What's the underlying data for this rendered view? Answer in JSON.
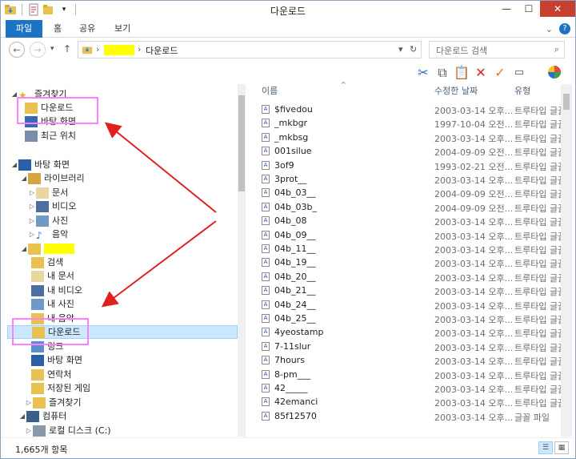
{
  "window": {
    "title": "다운로드",
    "controls": {
      "minimize": "—",
      "maximize": "☐",
      "close": "✕"
    }
  },
  "ribbon": {
    "tabs": [
      "파일",
      "홈",
      "공유",
      "보기"
    ],
    "expand": "⌄",
    "help": "?"
  },
  "address": {
    "crumb_sep": "›",
    "crumbs": [
      "다운로드"
    ],
    "refresh": "↻"
  },
  "search": {
    "placeholder": "다운로드 검색",
    "icon": "search-icon"
  },
  "toolbar": {
    "icons": [
      "scissors-icon",
      "copy-icon",
      "paste-icon",
      "delete-icon",
      "checkmark-icon",
      "rename-icon",
      "properties-icon"
    ]
  },
  "nav": {
    "favorites": "즐겨찾기",
    "favorites_items": [
      "다운로드",
      "바탕 화면",
      "최근 위치"
    ],
    "desktop": "바탕 화면",
    "libraries": "라이브러리",
    "library_items": [
      "문서",
      "비디오",
      "사진",
      "음악"
    ],
    "user_items": [
      "검색",
      "내 문서",
      "내 비디오",
      "내 사진",
      "내 음악",
      "다운로드",
      "링크",
      "바탕 화면",
      "연락처",
      "저장된 게임",
      "즐겨찾기"
    ],
    "computer": "컴퓨터",
    "local_disk": "로컬 디스크 (C:)"
  },
  "columns": {
    "name": "이름",
    "modified": "수정한 날짜",
    "type": "유형"
  },
  "files": [
    {
      "name": "$fivedou",
      "date": "2003-03-14 오후...",
      "type": "트루타입 글꼴"
    },
    {
      "name": "_mkbgr",
      "date": "1997-10-04 오전...",
      "type": "트루타입 글꼴"
    },
    {
      "name": "_mkbsg",
      "date": "2003-03-14 오후...",
      "type": "트루타입 글꼴"
    },
    {
      "name": "001silue",
      "date": "2004-09-09 오전...",
      "type": "트루타입 글꼴"
    },
    {
      "name": "3of9",
      "date": "1993-02-21 오전...",
      "type": "트루타입 글꼴"
    },
    {
      "name": "3prot__",
      "date": "2003-03-14 오후...",
      "type": "트루타입 글꼴"
    },
    {
      "name": "04b_03__",
      "date": "2004-09-09 오전...",
      "type": "트루타입 글꼴"
    },
    {
      "name": "04b_03b_",
      "date": "2004-09-09 오전...",
      "type": "트루타입 글꼴"
    },
    {
      "name": "04b_08",
      "date": "2003-03-14 오후...",
      "type": "트루타입 글꼴"
    },
    {
      "name": "04b_09__",
      "date": "2003-03-14 오후...",
      "type": "트루타입 글꼴"
    },
    {
      "name": "04b_11__",
      "date": "2003-03-14 오후...",
      "type": "트루타입 글꼴"
    },
    {
      "name": "04b_19__",
      "date": "2003-03-14 오후...",
      "type": "트루타입 글꼴"
    },
    {
      "name": "04b_20__",
      "date": "2003-03-14 오후...",
      "type": "트루타입 글꼴"
    },
    {
      "name": "04b_21__",
      "date": "2003-03-14 오후...",
      "type": "트루타입 글꼴"
    },
    {
      "name": "04b_24__",
      "date": "2003-03-14 오후...",
      "type": "트루타입 글꼴"
    },
    {
      "name": "04b_25__",
      "date": "2003-03-14 오후...",
      "type": "트루타입 글꼴"
    },
    {
      "name": "4yeostamp",
      "date": "2003-03-14 오후...",
      "type": "트루타입 글꼴"
    },
    {
      "name": "7-11slur",
      "date": "2003-03-14 오후...",
      "type": "트루타입 글꼴"
    },
    {
      "name": "7hours",
      "date": "2003-03-14 오후...",
      "type": "트루타입 글꼴"
    },
    {
      "name": "8-pm___",
      "date": "2003-03-14 오후...",
      "type": "트루타입 글꼴"
    },
    {
      "name": "42_____",
      "date": "2003-03-14 오후...",
      "type": "트루타입 글꼴"
    },
    {
      "name": "42emanci",
      "date": "2003-03-14 오후...",
      "type": "트루타입 글꼴"
    },
    {
      "name": "85f12570",
      "date": "2003-03-14 오후...",
      "type": "글꼴 파일"
    }
  ],
  "status": {
    "count": "1,665개 항목"
  },
  "colors": {
    "accent": "#1e74c4",
    "highlight": "#ffff00",
    "annotation": "#e02020",
    "annotation_box": "#ff80ff"
  }
}
